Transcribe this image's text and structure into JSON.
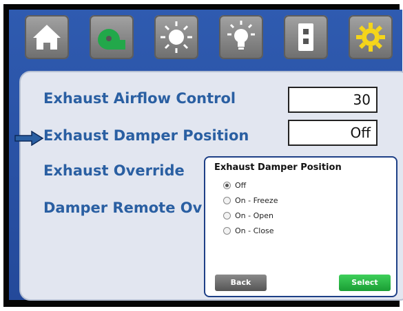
{
  "nav": {
    "items": [
      {
        "icon": "home-icon"
      },
      {
        "icon": "fan-icon",
        "color": "#22a84a"
      },
      {
        "icon": "sun-icon"
      },
      {
        "icon": "light-bulb-icon"
      },
      {
        "icon": "switch-icon"
      },
      {
        "icon": "gear-icon",
        "color": "#f5d51a"
      }
    ]
  },
  "settings": {
    "rows": [
      {
        "label": "Exhaust Airflow Control",
        "value": "30"
      },
      {
        "label": "Exhaust Damper Position",
        "value": "Off",
        "selected": true
      },
      {
        "label": "Exhaust Override"
      },
      {
        "label": "Damper Remote Ov"
      }
    ]
  },
  "dialog": {
    "title": "Exhaust Damper Position",
    "options": [
      "Off",
      "On - Freeze",
      "On - Open",
      "On - Close"
    ],
    "selected_option": "Off",
    "back_label": "Back",
    "select_label": "Select"
  },
  "colors": {
    "screen_bg": "#2b55a8",
    "label": "#2a5fa2",
    "select_button": "#22b33c"
  }
}
